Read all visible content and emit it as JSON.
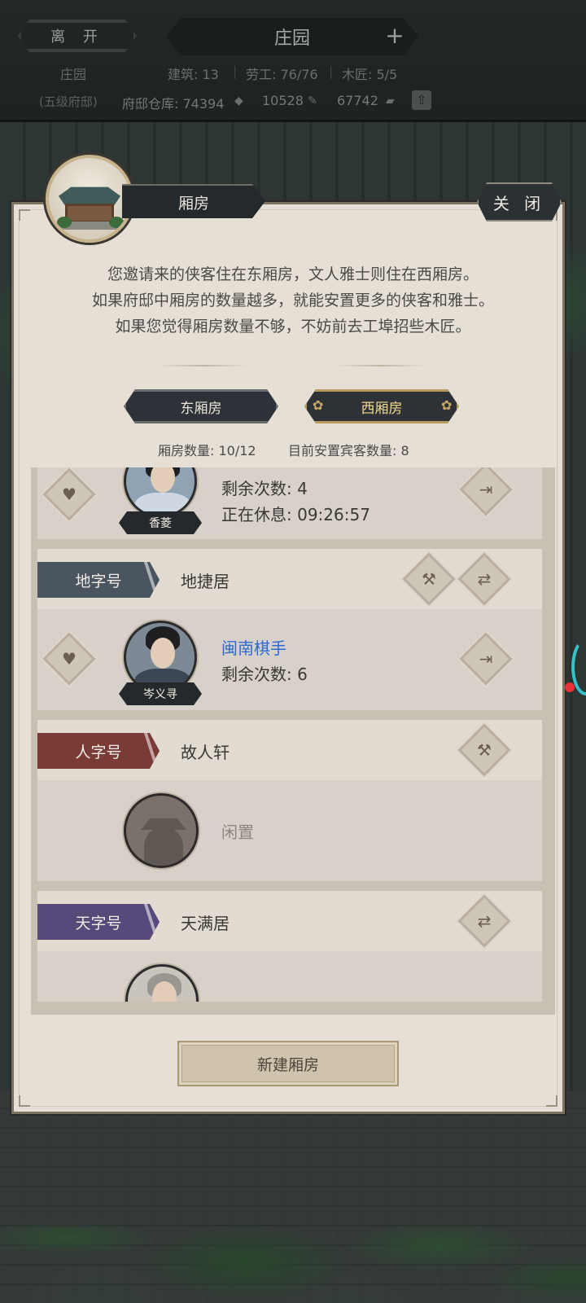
{
  "top_bar": {
    "leave_label": "离 开",
    "title": "庄园",
    "add_icon": "plus-icon",
    "manor_label": "庄园",
    "manor_level": "(五级府邸)",
    "stats": {
      "buildings": "建筑: 13",
      "laborers": "劳工: 76/76",
      "carpenters": "木匠: 5/5"
    },
    "storage_label": "府邸仓库: 74394",
    "res_2": "10528",
    "res_3": "67742"
  },
  "panel": {
    "title": "厢房",
    "close_label": "关 闭",
    "description": [
      "您邀请来的侠客住在东厢房，文人雅士则住在西厢房。",
      "如果府邸中厢房的数量越多，就能安置更多的侠客和雅士。",
      "如果您觉得厢房数量不够，不妨前去工埠招些木匠。"
    ],
    "tabs": {
      "east": "东厢房",
      "west": "西厢房"
    },
    "room_count": "厢房数量: 10/12",
    "guest_count": "目前安置宾客数量: 8",
    "new_room_label": "新建厢房"
  },
  "rooms": [
    {
      "guest_name": "香菱",
      "line1": "剩余次数: 4",
      "line2": "正在休息: 09:26:57"
    },
    {
      "tag": "地字号",
      "tag_color": "#4a5560",
      "name": "地捷居",
      "guest_name": "岑义寻",
      "line1": "闽南棋手",
      "line2": "剩余次数: 6"
    },
    {
      "tag": "人字号",
      "tag_color": "#7a3a36",
      "name": "故人轩",
      "status": "闲置"
    },
    {
      "tag": "天字号",
      "tag_color": "#574a7a",
      "name": "天满居"
    }
  ]
}
